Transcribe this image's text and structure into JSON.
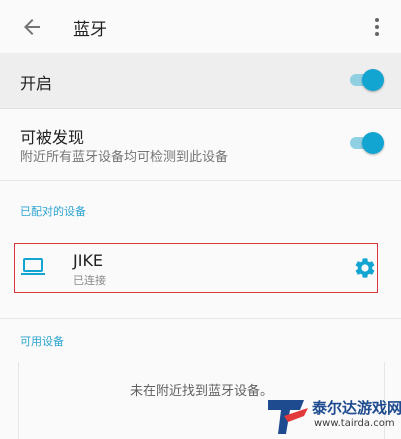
{
  "appbar": {
    "title": "蓝牙",
    "back_icon": "arrow-left-icon",
    "more_icon": "more-vertical-icon"
  },
  "settings": {
    "open_label": "开启",
    "open_enabled": true,
    "discoverable_label": "可被发现",
    "discoverable_desc": "附近所有蓝牙设备均可检测到此设备",
    "discoverable_enabled": true
  },
  "paired": {
    "section_title": "已配对的设备",
    "devices": [
      {
        "name": "JIKE",
        "status": "已连接",
        "icon": "laptop-icon",
        "settings_icon": "gear-icon"
      }
    ]
  },
  "available": {
    "section_title": "可用设备",
    "empty_text": "未在附近找到蓝牙设备。"
  },
  "watermark": {
    "text": "泰尔达游戏网",
    "url": "www.tairda.com"
  },
  "colors": {
    "accent": "#13a5d1",
    "section": "#2aa4cf",
    "highlight_border": "#d9363e"
  }
}
